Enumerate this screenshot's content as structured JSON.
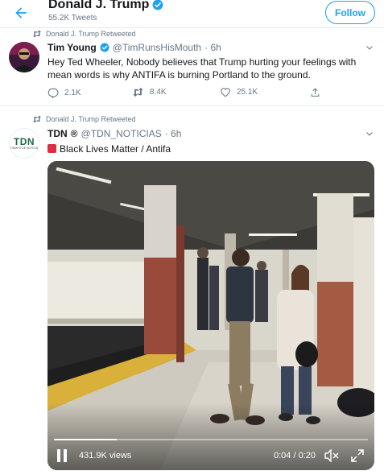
{
  "header": {
    "title": "Donald J. Trump",
    "tweet_count": "55.2K Tweets",
    "follow_label": "Follow"
  },
  "tweets": [
    {
      "retweet_label": "Donald J. Trump Retweeted",
      "name": "Tim Young",
      "handle": "@TimRunsHisMouth",
      "time": "· 6h",
      "text": "Hey Ted Wheeler, Nobody believes that Trump hurting your feelings with mean words is why ANTIFA is burning Portland to the ground.",
      "replies": "2.1K",
      "retweets": "8.4K",
      "likes": "25.1K"
    },
    {
      "retweet_label": "Donald J. Trump Retweeted",
      "name": "TDN",
      "name_mark": "®",
      "handle": "@TDN_NOTICIAS",
      "time": "· 6h",
      "text": "Black Lives Matter / Antifa",
      "avatar_text": "TDN",
      "avatar_subtext": "TIEMPO DE NOTICIA",
      "video": {
        "views": "431.9K views",
        "time": "0:04 / 0:20",
        "progress": 0.2
      }
    }
  ],
  "colors": {
    "accent": "#1da1f2",
    "text": "#14171a",
    "secondary": "#657786",
    "divider": "#e6ecf0"
  }
}
